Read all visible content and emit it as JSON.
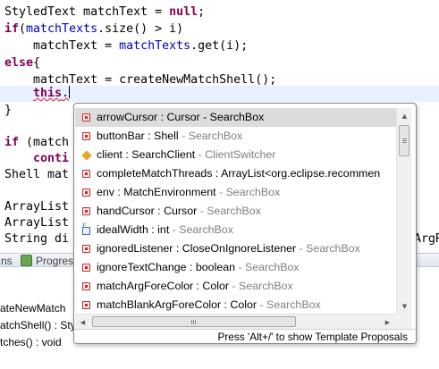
{
  "editor": {
    "lines": {
      "l1_type": "StyledText matchText = ",
      "l1_null": "null",
      "l1_end": ";",
      "l2_if": "if",
      "l2_open": "(",
      "l2_field": "matchTexts",
      "l2_rest": ".size() > i)",
      "l3_indent": "    matchText = ",
      "l3_field": "matchTexts",
      "l3_rest": ".get(i);",
      "l4_else": "else",
      "l4_brace": "{",
      "l5": "    matchText = createNewMatchShell();",
      "l6_indent": "    ",
      "l6_this": "this",
      "l6_dot": ".",
      "l7": "}",
      "l9_if": "if",
      "l9_rest": " (match",
      "l10_kw": "conti",
      "l11": "Shell mat",
      "l13": "ArrayList",
      "l14": "ArrayList",
      "l15": "String di",
      "l15_right": "ArgR"
    }
  },
  "bottom_panel": {
    "tab_partial": "ns",
    "tab_progress": "Progres",
    "outline_items": [
      "ateNewMatch",
      "atchShell() : Sty",
      "tches() : void"
    ]
  },
  "content_assist": {
    "proposals": [
      {
        "sig": "arrowCursor : Cursor - SearchBox",
        "qual": "",
        "icon": "protected-field-icon",
        "selected": true
      },
      {
        "sig": "buttonBar : Shell",
        "qual": " - SearchBox",
        "icon": "protected-field-icon"
      },
      {
        "sig": "client : SearchClient",
        "qual": " - ClientSwitcher",
        "icon": "default-field-icon"
      },
      {
        "sig": "completeMatchThreads : ArrayList<org.eclipse.recommen",
        "qual": "",
        "icon": "protected-field-icon"
      },
      {
        "sig": "env : MatchEnvironment",
        "qual": " - SearchBox",
        "icon": "protected-field-icon"
      },
      {
        "sig": "handCursor : Cursor",
        "qual": " - SearchBox",
        "icon": "protected-field-icon"
      },
      {
        "sig": "idealWidth : int",
        "qual": " - SearchBox",
        "icon": "final-field-icon"
      },
      {
        "sig": "ignoredListener : CloseOnIgnoreListener",
        "qual": " - SearchBox",
        "icon": "protected-field-icon"
      },
      {
        "sig": "ignoreTextChange : boolean",
        "qual": " - SearchBox",
        "icon": "protected-field-icon"
      },
      {
        "sig": "matchArgForeColor : Color",
        "qual": " - SearchBox",
        "icon": "protected-field-icon"
      },
      {
        "sig": "matchBlankArgForeColor : Color",
        "qual": " - SearchBox",
        "icon": "protected-field-icon"
      }
    ],
    "footer_hint": "Press 'Alt+/' to show Template Proposals",
    "scrollbar_icons": {
      "up": "scroll-up-arrow-icon",
      "down": "scroll-down-arrow-icon",
      "left": "scroll-left-arrow-icon",
      "right": "scroll-right-arrow-icon"
    }
  },
  "colors": {
    "keyword": "#7f0055",
    "field": "#0000c0",
    "current_line": "#e8f2fe",
    "selection": "#dcdcdc",
    "qualifier": "#7f7f7f"
  }
}
